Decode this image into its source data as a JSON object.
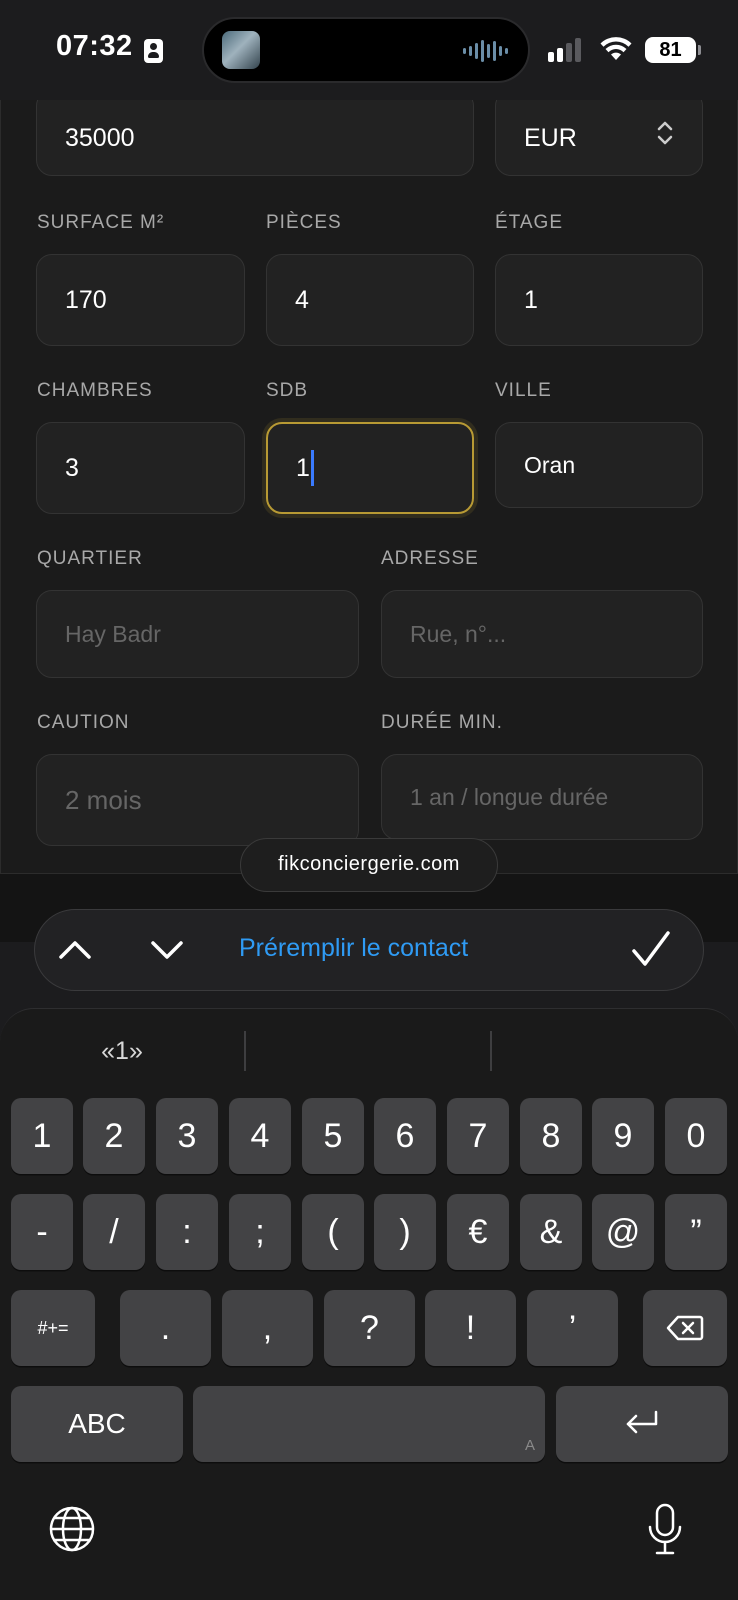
{
  "status_bar": {
    "time": "07:32",
    "battery": "81"
  },
  "form": {
    "price_value": "35000",
    "currency_value": "EUR",
    "surface_label": "SURFACE M²",
    "surface_value": "170",
    "rooms_label": "PIÈCES",
    "rooms_value": "4",
    "floor_label": "ÉTAGE",
    "floor_value": "1",
    "bedrooms_label": "CHAMBRES",
    "bedrooms_value": "3",
    "bathrooms_label": "SDB",
    "bathrooms_value": "1",
    "city_label": "VILLE",
    "city_value": "Oran",
    "district_label": "QUARTIER",
    "district_placeholder": "Hay Badr",
    "address_label": "ADRESSE",
    "address_placeholder": "Rue, n°...",
    "deposit_label": "CAUTION",
    "deposit_placeholder": "2 mois",
    "min_duration_label": "DURÉE MIN.",
    "min_duration_placeholder": "1 an / longue durée"
  },
  "domain_pill": "fikconciergerie.com",
  "accessory_bar": {
    "prefill_link": "Préremplir le contact"
  },
  "keyboard": {
    "suggestion": "«1»",
    "row1": [
      "1",
      "2",
      "3",
      "4",
      "5",
      "6",
      "7",
      "8",
      "9",
      "0"
    ],
    "row2": [
      "-",
      "/",
      ":",
      ";",
      "(",
      ")",
      "€",
      "&",
      "@",
      "”"
    ],
    "row3_shift": "#+=",
    "row3": [
      ".",
      ",",
      "?",
      "!",
      "’"
    ],
    "abc": "ABC",
    "space_mark": "A"
  },
  "colors": {
    "focus_border": "#b89a34",
    "link": "#2f9bf4",
    "caret": "#3a7bff"
  }
}
